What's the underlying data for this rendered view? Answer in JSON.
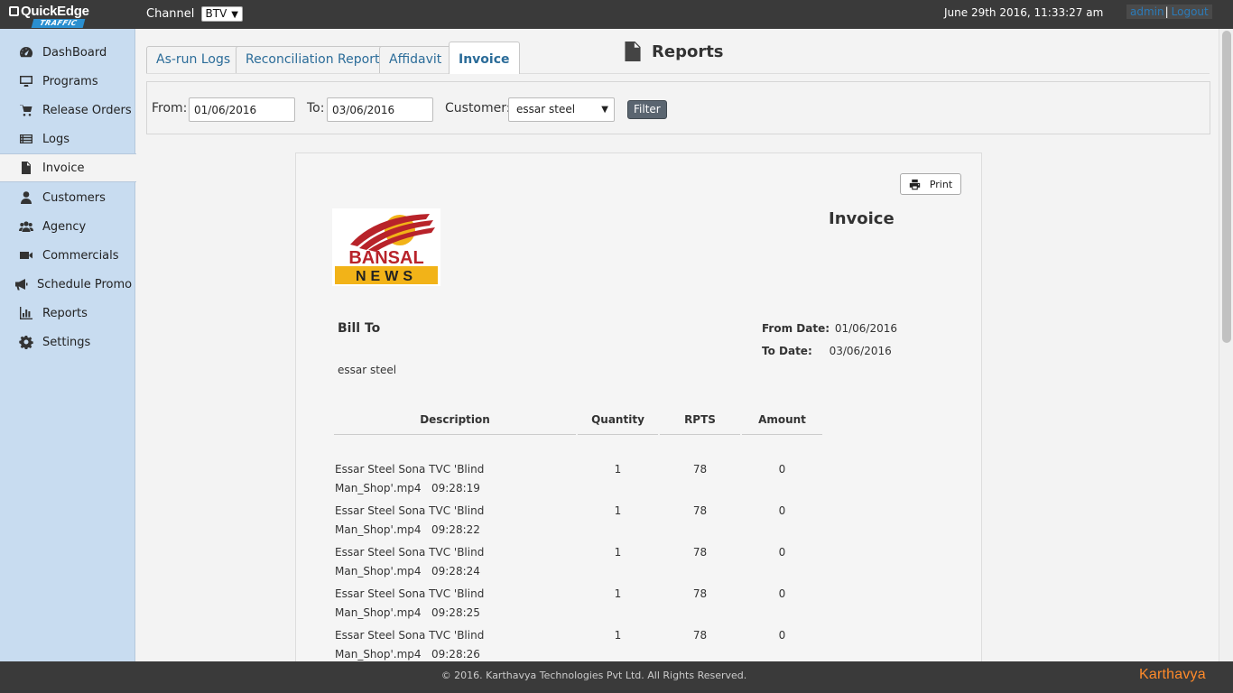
{
  "app": {
    "logo_text": "QuickEdge",
    "logo_sub": "TRAFFIC"
  },
  "header": {
    "channel_label": "Channel",
    "channel_value": "BTV",
    "datetime": "June 29th 2016, 11:33:27 am",
    "user_link": "admin",
    "separator": "|",
    "logout_link": "Logout"
  },
  "sidebar": {
    "items": [
      {
        "label": "DashBoard",
        "icon": "dashboard-icon"
      },
      {
        "label": "Programs",
        "icon": "monitor-icon"
      },
      {
        "label": "Release Orders",
        "icon": "cart-icon"
      },
      {
        "label": "Logs",
        "icon": "list-icon"
      },
      {
        "label": "Invoice",
        "icon": "file-icon",
        "active": true
      },
      {
        "label": "Customers",
        "icon": "user-icon"
      },
      {
        "label": "Agency",
        "icon": "users-icon"
      },
      {
        "label": "Commercials",
        "icon": "video-camera-icon"
      },
      {
        "label": "Schedule Promo",
        "icon": "bullhorn-icon"
      },
      {
        "label": "Reports",
        "icon": "bar-chart-icon"
      },
      {
        "label": "Settings",
        "icon": "gear-icon"
      }
    ]
  },
  "tabs": [
    {
      "label": "As-run Logs"
    },
    {
      "label": "Reconciliation Report"
    },
    {
      "label": "Affidavit"
    },
    {
      "label": "Invoice",
      "active": true
    }
  ],
  "page_title": "Reports",
  "filter": {
    "from_label": "From:",
    "from_value": "01/06/2016",
    "to_label": "To:",
    "to_value": "03/06/2016",
    "customer_label": "Customer:",
    "customer_value": "essar steel",
    "filter_button": "Filter"
  },
  "invoice": {
    "print_label": "Print",
    "title": "Invoice",
    "logo_text_top": "BANSAL",
    "logo_text_bottom": "NEWS",
    "bill_to_label": "Bill To",
    "customer_name": "essar steel",
    "from_date_label": "From Date:",
    "from_date_value": "01/06/2016",
    "to_date_label": "To Date:",
    "to_date_value": "03/06/2016",
    "columns": [
      "Description",
      "Quantity",
      "RPTS",
      "Amount"
    ],
    "rows": [
      {
        "desc_line1": "Essar Steel Sona TVC 'Blind",
        "desc_line2": "Man_Shop'.mp4   09:28:19",
        "quantity": "1",
        "rpts": "78",
        "amount": "0"
      },
      {
        "desc_line1": "Essar Steel Sona TVC 'Blind",
        "desc_line2": "Man_Shop'.mp4   09:28:22",
        "quantity": "1",
        "rpts": "78",
        "amount": "0"
      },
      {
        "desc_line1": "Essar Steel Sona TVC 'Blind",
        "desc_line2": "Man_Shop'.mp4   09:28:24",
        "quantity": "1",
        "rpts": "78",
        "amount": "0"
      },
      {
        "desc_line1": "Essar Steel Sona TVC 'Blind",
        "desc_line2": "Man_Shop'.mp4   09:28:25",
        "quantity": "1",
        "rpts": "78",
        "amount": "0"
      },
      {
        "desc_line1": "Essar Steel Sona TVC 'Blind",
        "desc_line2": "Man_Shop'.mp4   09:28:26",
        "quantity": "1",
        "rpts": "78",
        "amount": "0"
      }
    ]
  },
  "footer": {
    "copyright": "© 2016. Karthavya Technologies Pvt Ltd. All Rights Reserved.",
    "brand": "Karthavya"
  }
}
